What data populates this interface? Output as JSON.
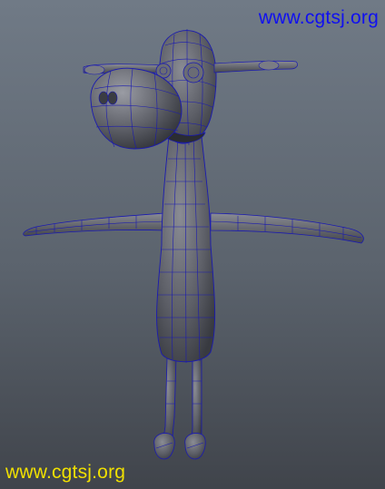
{
  "watermark": {
    "top_text": "www.cgtsj.org",
    "bottom_text": "www.cgtsj.org",
    "top_color": "#1010f0",
    "bottom_color": "#f0e000"
  },
  "scene": {
    "background_top": "#707a86",
    "background_bottom": "#40444b",
    "mesh_fill": "#5e6068",
    "wireframe_color": "#1a1ab0"
  }
}
